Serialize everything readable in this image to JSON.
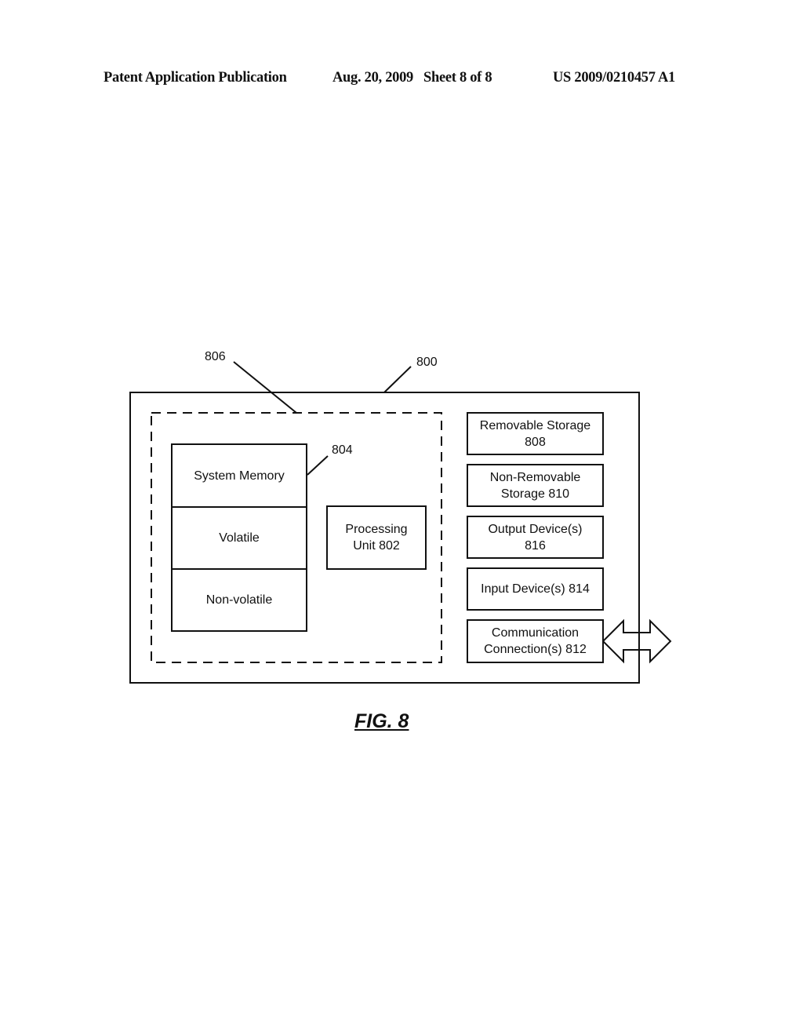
{
  "header": {
    "publication": "Patent Application Publication",
    "date_sheet": "Aug. 20, 2009   Sheet 8 of 8",
    "patent_number": "US 2009/0210457 A1"
  },
  "figure": {
    "caption": "FIG. 8",
    "ref_labels": {
      "device": "800",
      "basic_config": "806",
      "system_memory": "804"
    },
    "memory_stack": {
      "title": "System Memory",
      "volatile": "Volatile",
      "non_volatile": "Non-volatile"
    },
    "processing_unit": "Processing\nUnit 802",
    "peripherals": [
      "Removable Storage\n808",
      "Non-Removable\nStorage 810",
      "Output Device(s)\n816",
      "Input Device(s) 814",
      "Communication\nConnection(s) 812"
    ]
  }
}
